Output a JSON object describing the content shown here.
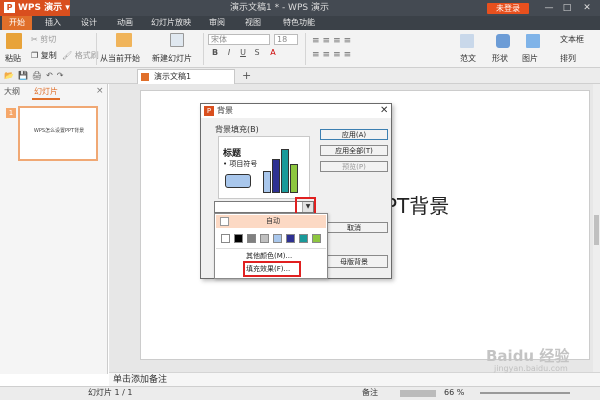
{
  "titlebar": {
    "app_label": "WPS 演示",
    "doc_title": "演示文稿1 * - WPS 演示",
    "login_label": "未登录",
    "minimize": "—",
    "maximize": "□",
    "close": "✕"
  },
  "menu_tabs": [
    "开始",
    "插入",
    "设计",
    "动画",
    "幻灯片放映",
    "审阅",
    "视图",
    "特色功能"
  ],
  "ribbon": {
    "paste": "粘贴",
    "cut": "剪切",
    "copy": "复制",
    "format_painter": "格式刷",
    "from_current": "从当前开始",
    "new_slide": "新建幻灯片",
    "font": "宋体",
    "font_size": "18",
    "template": "范文",
    "shape": "形状",
    "picture": "图片",
    "arrange": "排列",
    "textbox": "文本框"
  },
  "doc_tab": {
    "label": "演示文稿1",
    "add": "+"
  },
  "left_panel": {
    "tab_outline": "大纲",
    "tab_slides": "幻灯片",
    "close": "×",
    "thumb_number": "1",
    "thumb_text": "WPS怎么设置PPT背景"
  },
  "slide": {
    "title_visible": "PT背景"
  },
  "notes": {
    "placeholder": "单击添加备注"
  },
  "status": {
    "slide_count": "幻灯片 1 / 1",
    "notes_btn": "备注",
    "zoom": "66 %"
  },
  "dialog": {
    "title": "背景",
    "fill_label": "背景填充(B)",
    "preview_title": "标题",
    "preview_bullet": "• 项目符号",
    "btn_apply": "应用(A)",
    "btn_apply_all": "应用全部(T)",
    "btn_preview": "预览(P)",
    "btn_cancel": "取消",
    "btn_master": "母版背景",
    "close": "✕"
  },
  "color_dropdown": {
    "auto_label": "自动",
    "more_colors": "其他颜色(M)...",
    "fill_effects": "填充效果(F)...",
    "swatches": [
      "#ffffff",
      "#000000",
      "#808080",
      "#c0c0c0",
      "#a9c7ec",
      "#2e3192",
      "#1a9a9a",
      "#8dc63f"
    ]
  },
  "preview_bars": [
    {
      "color": "#a9c7ec",
      "level": 0.45
    },
    {
      "color": "#2e3192",
      "level": 0.7
    },
    {
      "color": "#1a9a9a",
      "level": 0.92
    },
    {
      "color": "#8dc63f",
      "level": 0.6
    }
  ],
  "watermark": {
    "logo": "Baidu 经验",
    "url": "jingyan.baidu.com"
  }
}
